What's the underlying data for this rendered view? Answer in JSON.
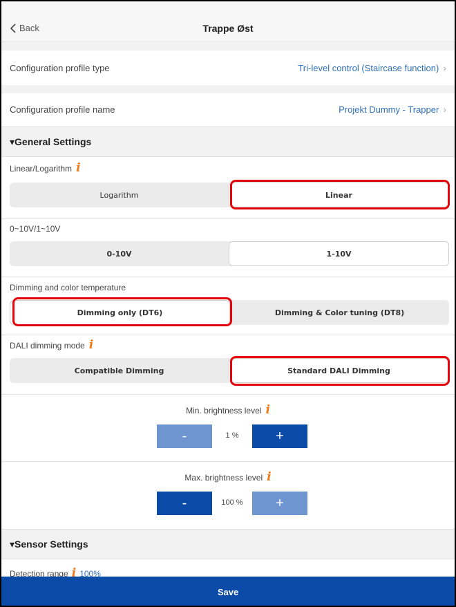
{
  "nav": {
    "back_label": "Back",
    "title": "Trappe Øst"
  },
  "profile": {
    "type_label": "Configuration profile type",
    "type_value": "Tri-level control (Staircase function)",
    "name_label": "Configuration profile name",
    "name_value": "Projekt Dummy - Trapper"
  },
  "general": {
    "header": "▾General Settings",
    "linear_log": {
      "label": "Linear/Logarithm",
      "options": [
        "Logarithm",
        "Linear"
      ],
      "selected": "Linear"
    },
    "voltage": {
      "label": "0~10V/1~10V",
      "options": [
        "0-10V",
        "1-10V"
      ],
      "selected": "1-10V"
    },
    "dimming_color": {
      "label": "Dimming and color temperature",
      "options": [
        "Dimming only (DT6)",
        "Dimming & Color tuning (DT8)"
      ],
      "selected": "Dimming only (DT6)"
    },
    "dali_mode": {
      "label": "DALI dimming mode",
      "options": [
        "Compatible Dimming",
        "Standard DALI Dimming"
      ],
      "selected": "Standard DALI Dimming"
    },
    "min_brightness": {
      "label": "Min. brightness level",
      "value": "1 %",
      "minus": "-",
      "plus": "+"
    },
    "max_brightness": {
      "label": "Max. brightness level",
      "value": "100 %",
      "minus": "-",
      "plus": "+"
    }
  },
  "sensor": {
    "header": "▾Sensor Settings",
    "detection_label": "Detection range",
    "detection_value": "100%"
  },
  "save_label": "Save",
  "colors": {
    "primary": "#0b4aa6",
    "primary_light": "#6f95d0",
    "info": "#f07a1a",
    "highlight": "#e3050b",
    "link": "#2f6fb8"
  },
  "icons": {
    "back": "chevron-left-icon",
    "disclosure": "chevron-right-icon",
    "info": "info-icon"
  }
}
